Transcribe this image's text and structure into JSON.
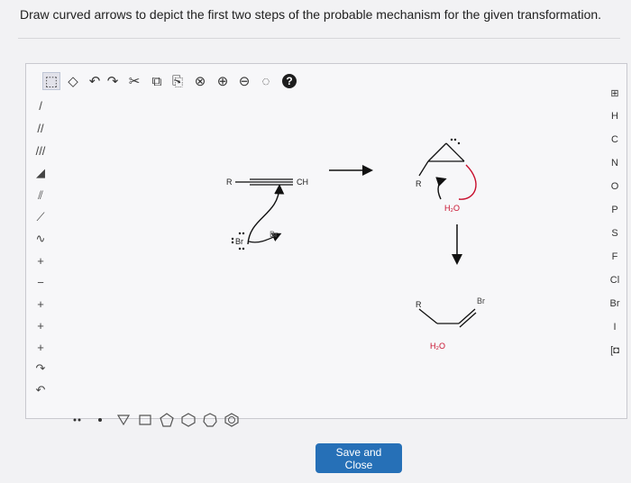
{
  "question": {
    "prompt": "Draw curved arrows to depict the first two steps of the probable mechanism for the given transformation."
  },
  "toolbar_top": {
    "tools": [
      {
        "name": "select-tool",
        "icon": "select-arrow-icon",
        "glyph": "⬚"
      },
      {
        "name": "erase-tool",
        "icon": "eraser-icon",
        "glyph": "◇"
      },
      {
        "name": "undo-tool",
        "icon": "undo-icon",
        "glyph": "↶"
      },
      {
        "name": "redo-tool",
        "icon": "redo-icon",
        "glyph": "↷"
      },
      {
        "name": "cut-tool",
        "icon": "scissors-icon",
        "glyph": "✂"
      },
      {
        "name": "copy-tool",
        "icon": "copy-icon",
        "glyph": "⧉"
      },
      {
        "name": "paste-tool",
        "icon": "paste-icon",
        "glyph": "⎘"
      },
      {
        "name": "clean-tool",
        "icon": "clean-icon",
        "glyph": "⊗"
      },
      {
        "name": "zoom-in-tool",
        "icon": "zoom-in-icon",
        "glyph": "⊕"
      },
      {
        "name": "zoom-out-tool",
        "icon": "zoom-out-icon",
        "glyph": "⊖"
      },
      {
        "name": "zoom-fit-tool",
        "icon": "zoom-fit-icon",
        "glyph": "◌"
      },
      {
        "name": "help-tool",
        "icon": "help-icon",
        "glyph": "?"
      }
    ]
  },
  "toolbar_left": {
    "tools": [
      {
        "name": "single-bond-tool",
        "icon": "single-bond-icon",
        "glyph": "/"
      },
      {
        "name": "double-bond-tool",
        "icon": "double-bond-icon",
        "glyph": "//"
      },
      {
        "name": "triple-bond-tool",
        "icon": "triple-bond-icon",
        "glyph": "///"
      },
      {
        "name": "wedge-bond-tool",
        "icon": "wedge-bond-icon",
        "glyph": "◢"
      },
      {
        "name": "hash-bond-tool",
        "icon": "hash-bond-icon",
        "glyph": "⫽"
      },
      {
        "name": "chain-tool",
        "icon": "chain-icon",
        "glyph": "⟋"
      },
      {
        "name": "wavy-bond-tool",
        "icon": "wavy-bond-icon",
        "glyph": "∿"
      },
      {
        "name": "positive-charge-tool",
        "icon": "plus-charge-icon",
        "glyph": "+"
      },
      {
        "name": "negative-charge-tool",
        "icon": "minus-charge-icon",
        "glyph": "−"
      },
      {
        "name": "lone-pair-tool",
        "icon": "lone-pair-icon",
        "glyph": "+"
      },
      {
        "name": "radical-tool",
        "icon": "radical-icon",
        "glyph": "+"
      },
      {
        "name": "electron-pair-tool",
        "icon": "electron-pair-icon",
        "glyph": "+"
      },
      {
        "name": "arrow-pair-tool",
        "icon": "curved-arrow-pair-icon",
        "glyph": "↷"
      },
      {
        "name": "arrow-single-tool",
        "icon": "curved-arrow-single-icon",
        "glyph": "↶"
      }
    ]
  },
  "toolbar_right": {
    "elements": [
      {
        "name": "periodic-table-tool",
        "label": "⊞"
      },
      {
        "name": "element-h",
        "label": "H"
      },
      {
        "name": "element-c",
        "label": "C"
      },
      {
        "name": "element-n",
        "label": "N"
      },
      {
        "name": "element-o",
        "label": "O"
      },
      {
        "name": "element-p",
        "label": "P"
      },
      {
        "name": "element-s",
        "label": "S"
      },
      {
        "name": "element-f",
        "label": "F"
      },
      {
        "name": "element-cl",
        "label": "Cl"
      },
      {
        "name": "element-br",
        "label": "Br"
      },
      {
        "name": "element-i",
        "label": "I"
      },
      {
        "name": "element-more",
        "label": "[◘"
      }
    ]
  },
  "toolbar_bottom": {
    "shapes": [
      {
        "name": "dots-tool",
        "icon": "dots-icon"
      },
      {
        "name": "dot-tool",
        "icon": "dot-icon"
      },
      {
        "name": "cyclopropane-tool",
        "icon": "triangle-ring-icon"
      },
      {
        "name": "cyclobutane-tool",
        "icon": "square-ring-icon"
      },
      {
        "name": "cyclopentane-tool",
        "icon": "pentagon-ring-icon"
      },
      {
        "name": "cyclohexane-tool",
        "icon": "hexagon-ring-icon"
      },
      {
        "name": "cycloheptane-tool",
        "icon": "heptagon-ring-icon"
      },
      {
        "name": "benzene-tool",
        "icon": "benzene-ring-icon"
      }
    ]
  },
  "molecules": {
    "r_alkyne": "R",
    "ch_alkyne": "CH",
    "br_ion": "Br",
    "r_intermediate": "R",
    "h2o_top": "H₂O",
    "r_product": "R",
    "br_product": "Br",
    "h2o_product": "H₂O"
  },
  "actions": {
    "save_label": "Save and Close"
  },
  "colors": {
    "accent": "#2670b7",
    "red": "#c8102e",
    "highlight": "#e2e2ea"
  }
}
